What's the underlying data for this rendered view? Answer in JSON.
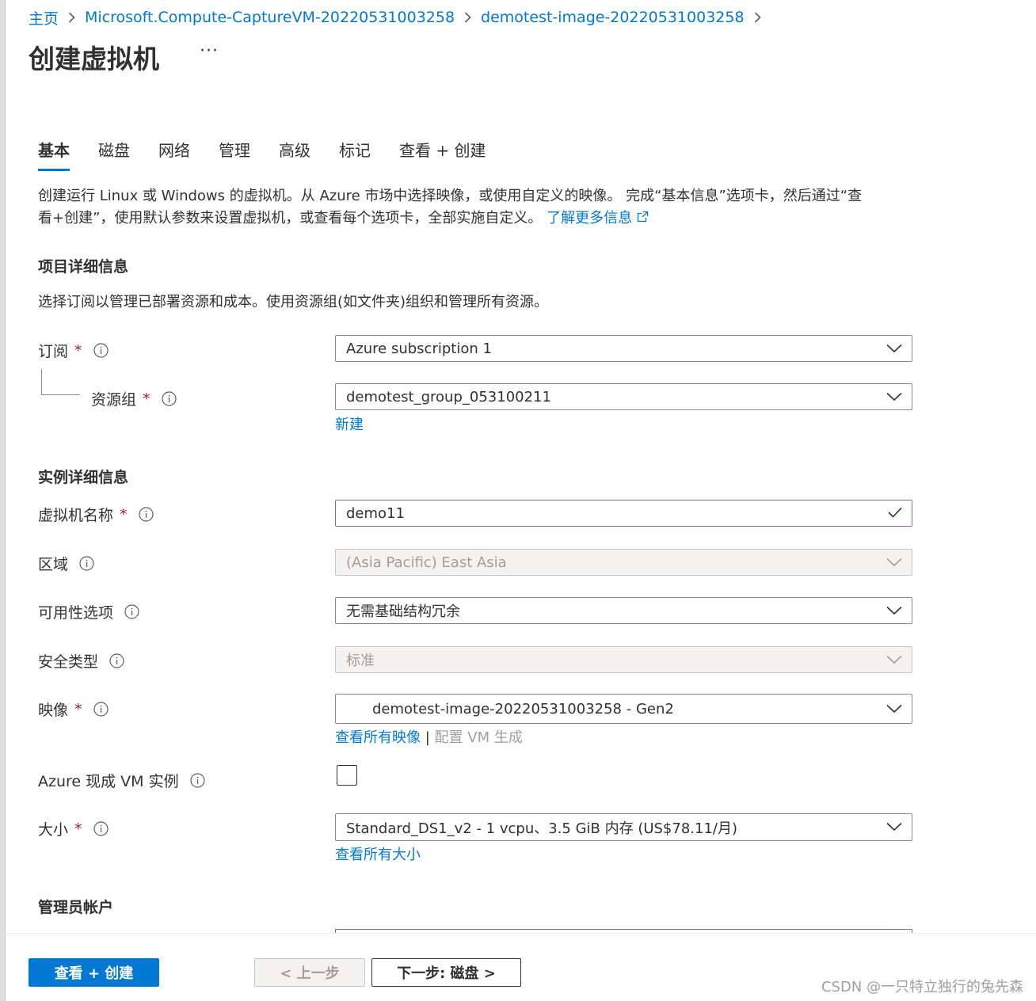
{
  "breadcrumb": {
    "items": [
      "主页",
      "Microsoft.Compute-CaptureVM-20220531003258",
      "demotest-image-20220531003258"
    ]
  },
  "header": {
    "title": "创建虚拟机",
    "more": "···"
  },
  "tabs": [
    {
      "label": "基本",
      "active": true
    },
    {
      "label": "磁盘"
    },
    {
      "label": "网络"
    },
    {
      "label": "管理"
    },
    {
      "label": "高级"
    },
    {
      "label": "标记"
    },
    {
      "label": "查看 + 创建"
    }
  ],
  "intro": {
    "line1": "创建运行 Linux 或 Windows 的虚拟机。从 Azure 市场中选择映像，或使用自定义的映像。 完成“基本信息”选项卡，然后通过“查",
    "line2": "看+创建”，使用默认参数来设置虚拟机，或查看每个选项卡，全部实施自定义。",
    "learn_more": "了解更多信息"
  },
  "project": {
    "heading": "项目详细信息",
    "desc": "选择订阅以管理已部署资源和成本。使用资源组(如文件夹)组织和管理所有资源。",
    "subscription": {
      "label": "订阅",
      "value": "Azure subscription 1"
    },
    "resource_group": {
      "label": "资源组",
      "value": "demotest_group_053100211",
      "new_link": "新建"
    }
  },
  "instance": {
    "heading": "实例详细信息",
    "vm_name": {
      "label": "虚拟机名称",
      "value": "demo11"
    },
    "region": {
      "label": "区域",
      "value": "(Asia Pacific) East Asia"
    },
    "availability": {
      "label": "可用性选项",
      "value": "无需基础结构冗余"
    },
    "security": {
      "label": "安全类型",
      "value": "标准"
    },
    "image": {
      "label": "映像",
      "value": "demotest-image-20220531003258 - Gen2",
      "see_all": "查看所有映像",
      "separator": "|",
      "configure": "配置 VM 生成"
    },
    "spot": {
      "label": "Azure 现成 VM 实例",
      "checked": false
    },
    "size": {
      "label": "大小",
      "value": "Standard_DS1_v2 - 1 vcpu、3.5 GiB 内存 (US$78.11/月)",
      "see_all": "查看所有大小"
    }
  },
  "admin": {
    "heading": "管理员帐户"
  },
  "footer": {
    "review_create": "查看 + 创建",
    "prev": "< 上一步",
    "next": "下一步: 磁盘 >"
  },
  "required_mark": "*",
  "watermark": "CSDN @一只特立独行的兔先森",
  "colors": {
    "accent": "#0078d4",
    "required": "#a4262c",
    "valid_border": "#8764b8",
    "text": "#323130",
    "disabled_bg": "#f3f2f1"
  }
}
